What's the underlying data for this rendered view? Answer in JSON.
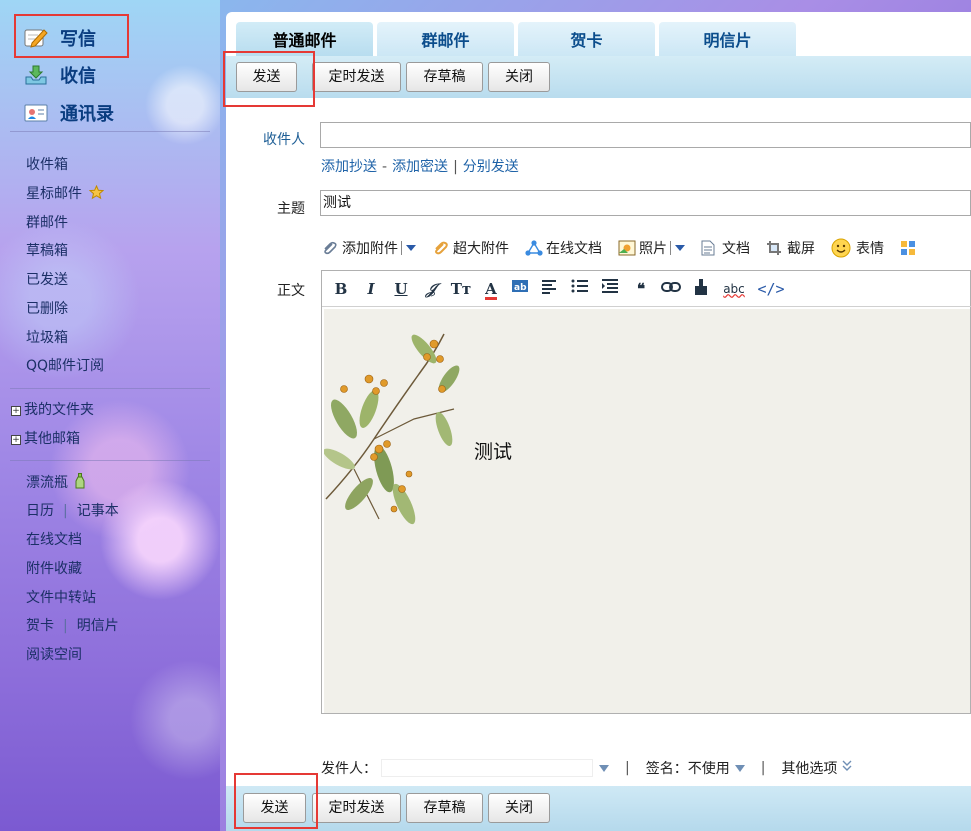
{
  "sidebar": {
    "primary": {
      "compose": "写信",
      "inbox": "收信",
      "contacts": "通讯录"
    },
    "folders": [
      "收件箱",
      "星标邮件",
      "群邮件",
      "草稿箱",
      "已发送",
      "已删除",
      "垃圾箱",
      "QQ邮件订阅"
    ],
    "my_folders": "我的文件夹",
    "other_mailboxes": "其他邮箱",
    "drift_bottle": "漂流瓶",
    "calendar": "日历",
    "notepad": "记事本",
    "online_docs": "在线文档",
    "attachment_fav": "附件收藏",
    "file_transfer": "文件中转站",
    "greeting_card": "贺卡",
    "postcard": "明信片",
    "reading_space": "阅读空间"
  },
  "tabs": [
    "普通邮件",
    "群邮件",
    "贺卡",
    "明信片"
  ],
  "toolbar": {
    "send": "发送",
    "scheduled_send": "定时发送",
    "save_draft": "存草稿",
    "close": "关闭"
  },
  "form": {
    "recipient_label": "收件人",
    "recipient_value": "",
    "add_cc": "添加抄送",
    "dash": "-",
    "add_bcc": "添加密送",
    "separate_send": "分别发送",
    "subject_label": "主题",
    "subject_value": "测试",
    "body_label": "正文"
  },
  "attach": {
    "add_attachment": "添加附件",
    "large_attachment": "超大附件",
    "online_doc": "在线文档",
    "photo": "照片",
    "document": "文档",
    "screenshot": "截屏",
    "emoji": "表情"
  },
  "editor": {
    "body_text": "测试"
  },
  "footer": {
    "sender_label": "发件人：",
    "signature_label": "签名：不使用",
    "other_options": "其他选项"
  }
}
